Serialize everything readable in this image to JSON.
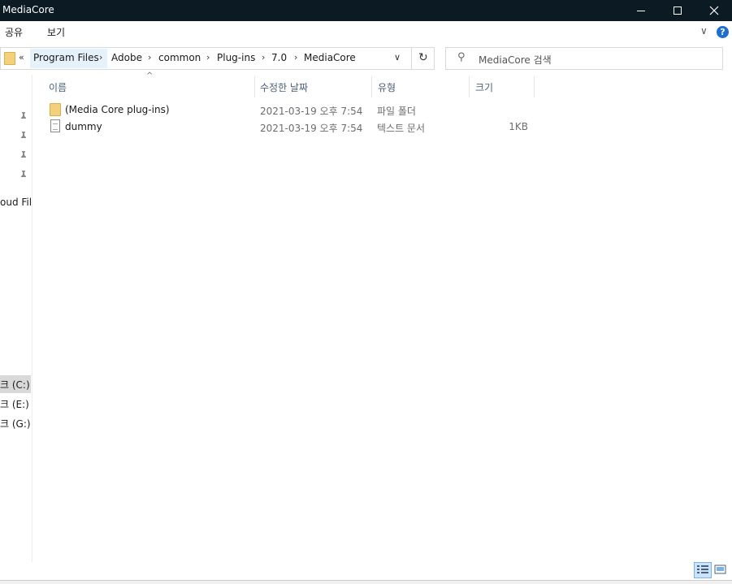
{
  "window": {
    "title": "MediaCore",
    "minimize_icon": "minimize-icon",
    "maximize_icon": "maximize-icon",
    "close_icon": "close-icon"
  },
  "ribbon": {
    "tabs": [
      {
        "label": "공유"
      },
      {
        "label": "보기"
      }
    ],
    "expand_glyph": "∨",
    "help_glyph": "?"
  },
  "address": {
    "overflow_glyph": "«",
    "crumbs": [
      {
        "label": "Program Files"
      },
      {
        "label": "Adobe"
      },
      {
        "label": "common"
      },
      {
        "label": "Plug-ins"
      },
      {
        "label": "7.0"
      },
      {
        "label": "MediaCore"
      }
    ],
    "separator": "›",
    "dropdown_glyph": "∨",
    "refresh_glyph": "↻"
  },
  "search": {
    "placeholder": "MediaCore 검색",
    "icon_glyph": "⚲"
  },
  "nav": {
    "pin_glyph": "📌",
    "items": [
      {
        "label": "oud File"
      },
      {
        "label": "크 (C:)"
      },
      {
        "label": "크 (E:)"
      },
      {
        "label": "크 (G:)"
      }
    ]
  },
  "columns": {
    "name": "이름",
    "date": "수정한 날짜",
    "type": "유형",
    "size": "크기",
    "sort_glyph": "^"
  },
  "files": [
    {
      "name": "(Media Core plug-ins)",
      "date": "2021-03-19 오후 7:54",
      "type": "파일 폴더",
      "size": "",
      "icon": "folder-icon"
    },
    {
      "name": "dummy",
      "date": "2021-03-19 오후 7:54",
      "type": "텍스트 문서",
      "size": "1KB",
      "icon": "text-document-icon"
    }
  ],
  "colors": {
    "titlebar": "#0c1a24",
    "folder": "#f5d07a",
    "selection": "#cce4f7",
    "help": "#1f6fd0"
  }
}
